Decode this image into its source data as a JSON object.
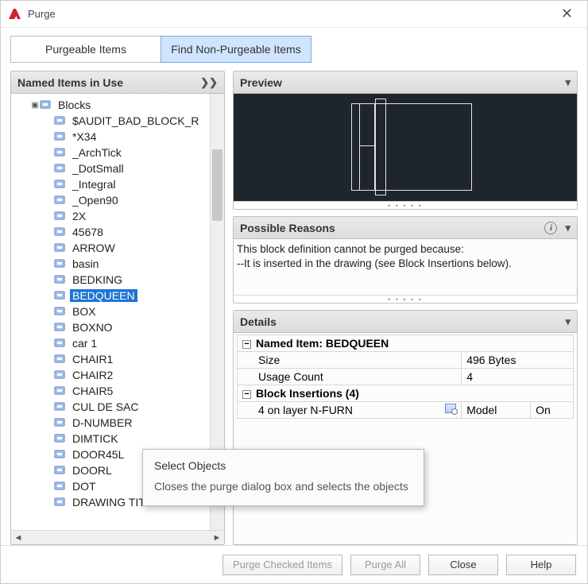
{
  "window": {
    "title": "Purge"
  },
  "tabs": {
    "purgeable": "Purgeable Items",
    "nonpurge": "Find Non-Purgeable Items"
  },
  "tree": {
    "header": "Named Items in Use",
    "root": "Blocks",
    "items": [
      "$AUDIT_BAD_BLOCK_R",
      "*X34",
      "_ArchTick",
      "_DotSmall",
      "_Integral",
      "_Open90",
      "2X",
      "45678",
      "ARROW",
      "basin",
      "BEDKING",
      "BEDQUEEN",
      "BOX",
      "BOXNO",
      "car 1",
      "CHAIR1",
      "CHAIR2",
      "CHAIR5",
      "CUL DE SAC",
      "D-NUMBER",
      "DIMTICK",
      "DOOR45L",
      "DOORL",
      "DOT",
      "DRAWING TITLE"
    ],
    "selected": "BEDQUEEN"
  },
  "preview": {
    "header": "Preview"
  },
  "reasons": {
    "header": "Possible Reasons",
    "line1": "This block definition cannot be purged because:",
    "line2": "--It is inserted in the drawing (see Block Insertions below)."
  },
  "details": {
    "header": "Details",
    "named_item_label": "Named Item: BEDQUEEN",
    "size_label": "Size",
    "size_value": "496 Bytes",
    "usage_label": "Usage Count",
    "usage_value": "4",
    "insertions_label": "Block Insertions (4)",
    "row_layer": "4 on layer N-FURN",
    "row_space": "Model",
    "row_state": "On"
  },
  "tooltip": {
    "title": "Select Objects",
    "body": "Closes the purge dialog box and selects the objects"
  },
  "buttons": {
    "purge_checked": "Purge Checked Items",
    "purge_all": "Purge All",
    "close": "Close",
    "help": "Help"
  }
}
